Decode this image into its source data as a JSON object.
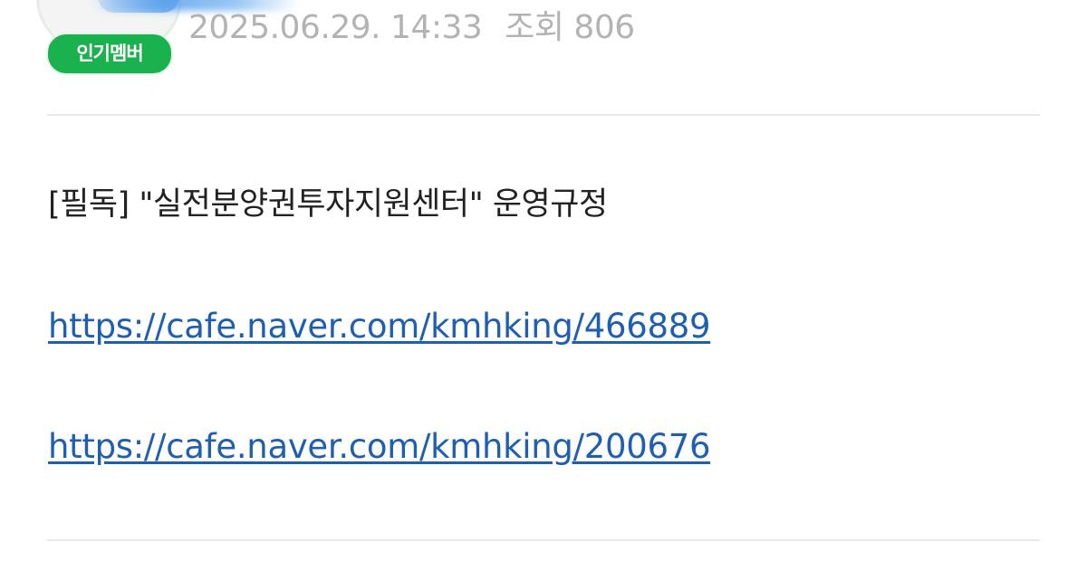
{
  "author": {
    "badge": "인기멤버"
  },
  "post_meta": {
    "date": "2025.06.29. 14:33",
    "views_label": "조회",
    "views_count": "806"
  },
  "body": {
    "title_line": "[필독] \"실전분양권투자지원센터\" 운영규정",
    "links": [
      "https://cafe.naver.com/kmhking/466889",
      "https://cafe.naver.com/kmhking/200676"
    ]
  },
  "colors": {
    "badge_bg": "#19b24f",
    "link": "#1e5fb4",
    "meta_text": "#b3b3b3",
    "body_text": "#222222"
  }
}
